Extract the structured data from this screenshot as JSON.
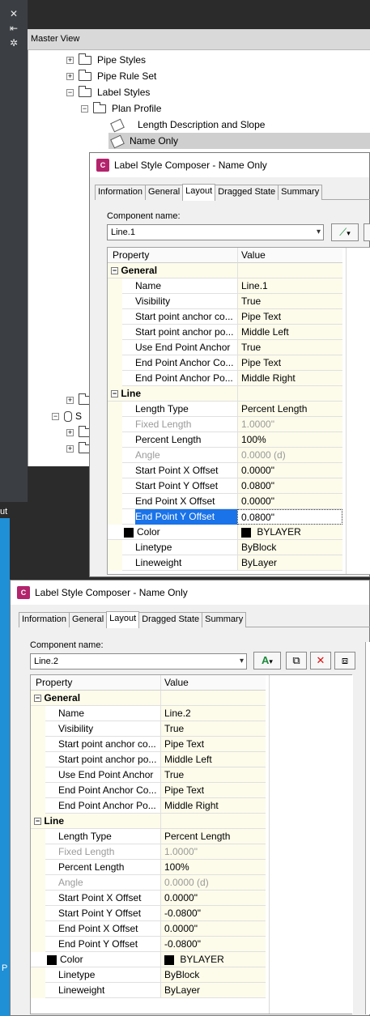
{
  "palette": {
    "close": "✕",
    "pin": "⇤",
    "props": "✲"
  },
  "tree": {
    "bar_title": "Master View",
    "items": [
      {
        "label": "Pipe Styles",
        "level": 1
      },
      {
        "label": "Pipe Rule Set",
        "level": 1
      },
      {
        "label": "Label Styles",
        "level": 1
      },
      {
        "label": "Plan Profile",
        "level": 2
      },
      {
        "label": "Length Description and Slope",
        "level": 3
      },
      {
        "label": "Name Only",
        "level": 3,
        "selected": true
      }
    ],
    "partial": "S",
    "left_fragment": "ut",
    "left_fragment2": "P"
  },
  "dialog1": {
    "title": "Label Style Composer - Name Only",
    "tabs": [
      "Information",
      "General",
      "Layout",
      "Dragged State",
      "Summary"
    ],
    "active_tab": "Layout",
    "component_label": "Component name:",
    "component_value": "Line.1",
    "grid": {
      "header": [
        "Property",
        "Value"
      ],
      "general_label": "General",
      "rows_general": [
        {
          "p": "Name",
          "v": "Line.1"
        },
        {
          "p": "Visibility",
          "v": "True"
        },
        {
          "p": "Start point anchor co...",
          "v": "Pipe Text"
        },
        {
          "p": "Start point anchor po...",
          "v": "Middle Left"
        },
        {
          "p": "Use End Point Anchor",
          "v": "True"
        },
        {
          "p": "End Point Anchor Co...",
          "v": "Pipe Text"
        },
        {
          "p": "End Point Anchor Po...",
          "v": "Middle Right"
        }
      ],
      "line_label": "Line",
      "rows_line": [
        {
          "p": "Length Type",
          "v": "Percent Length"
        },
        {
          "p": "Fixed Length",
          "v": "1.0000\"",
          "grey": true
        },
        {
          "p": "Percent Length",
          "v": "100%"
        },
        {
          "p": "Angle",
          "v": "0.0000 (d)",
          "grey": true
        },
        {
          "p": "Start Point X Offset",
          "v": "0.0000\""
        },
        {
          "p": "Start Point Y Offset",
          "v": "0.0800\""
        },
        {
          "p": "End Point X Offset",
          "v": "0.0000\""
        },
        {
          "p": "End Point Y Offset",
          "v": "0.0800\"",
          "selected": true
        },
        {
          "p": "Color",
          "v": "BYLAYER",
          "swatch": true
        },
        {
          "p": "Linetype",
          "v": "ByBlock"
        },
        {
          "p": "Lineweight",
          "v": "ByLayer"
        }
      ]
    }
  },
  "dialog2": {
    "title": "Label Style Composer - Name Only",
    "tabs": [
      "Information",
      "General",
      "Layout",
      "Dragged State",
      "Summary"
    ],
    "active_tab": "Layout",
    "component_label": "Component name:",
    "component_value": "Line.2",
    "grid": {
      "header": [
        "Property",
        "Value"
      ],
      "general_label": "General",
      "rows_general": [
        {
          "p": "Name",
          "v": "Line.2"
        },
        {
          "p": "Visibility",
          "v": "True"
        },
        {
          "p": "Start point anchor co...",
          "v": "Pipe Text"
        },
        {
          "p": "Start point anchor po...",
          "v": "Middle Left"
        },
        {
          "p": "Use End Point Anchor",
          "v": "True"
        },
        {
          "p": "End Point Anchor Co...",
          "v": "Pipe Text"
        },
        {
          "p": "End Point Anchor Po...",
          "v": "Middle Right"
        }
      ],
      "line_label": "Line",
      "rows_line": [
        {
          "p": "Length Type",
          "v": "Percent Length"
        },
        {
          "p": "Fixed Length",
          "v": "1.0000\"",
          "grey": true
        },
        {
          "p": "Percent Length",
          "v": "100%"
        },
        {
          "p": "Angle",
          "v": "0.0000 (d)",
          "grey": true
        },
        {
          "p": "Start Point X Offset",
          "v": "0.0000\""
        },
        {
          "p": "Start Point Y Offset",
          "v": "-0.0800\""
        },
        {
          "p": "End Point X Offset",
          "v": "0.0000\""
        },
        {
          "p": "End Point Y Offset",
          "v": "-0.0800\""
        },
        {
          "p": "Color",
          "v": "BYLAYER",
          "swatch": true
        },
        {
          "p": "Linetype",
          "v": "ByBlock"
        },
        {
          "p": "Lineweight",
          "v": "ByLayer"
        }
      ]
    }
  },
  "colors": {
    "selection": "#1a73e8",
    "value_bg": "#fdfbea",
    "brand": "#b3246d",
    "side_blue": "#1f8fd6"
  },
  "icons": [
    "close-icon",
    "pin-icon",
    "properties-icon",
    "folder-icon",
    "label-style-icon",
    "civil3d-icon",
    "add-text-icon",
    "copy-icon",
    "delete-icon",
    "pages-icon",
    "dropdown-arrow-icon"
  ]
}
